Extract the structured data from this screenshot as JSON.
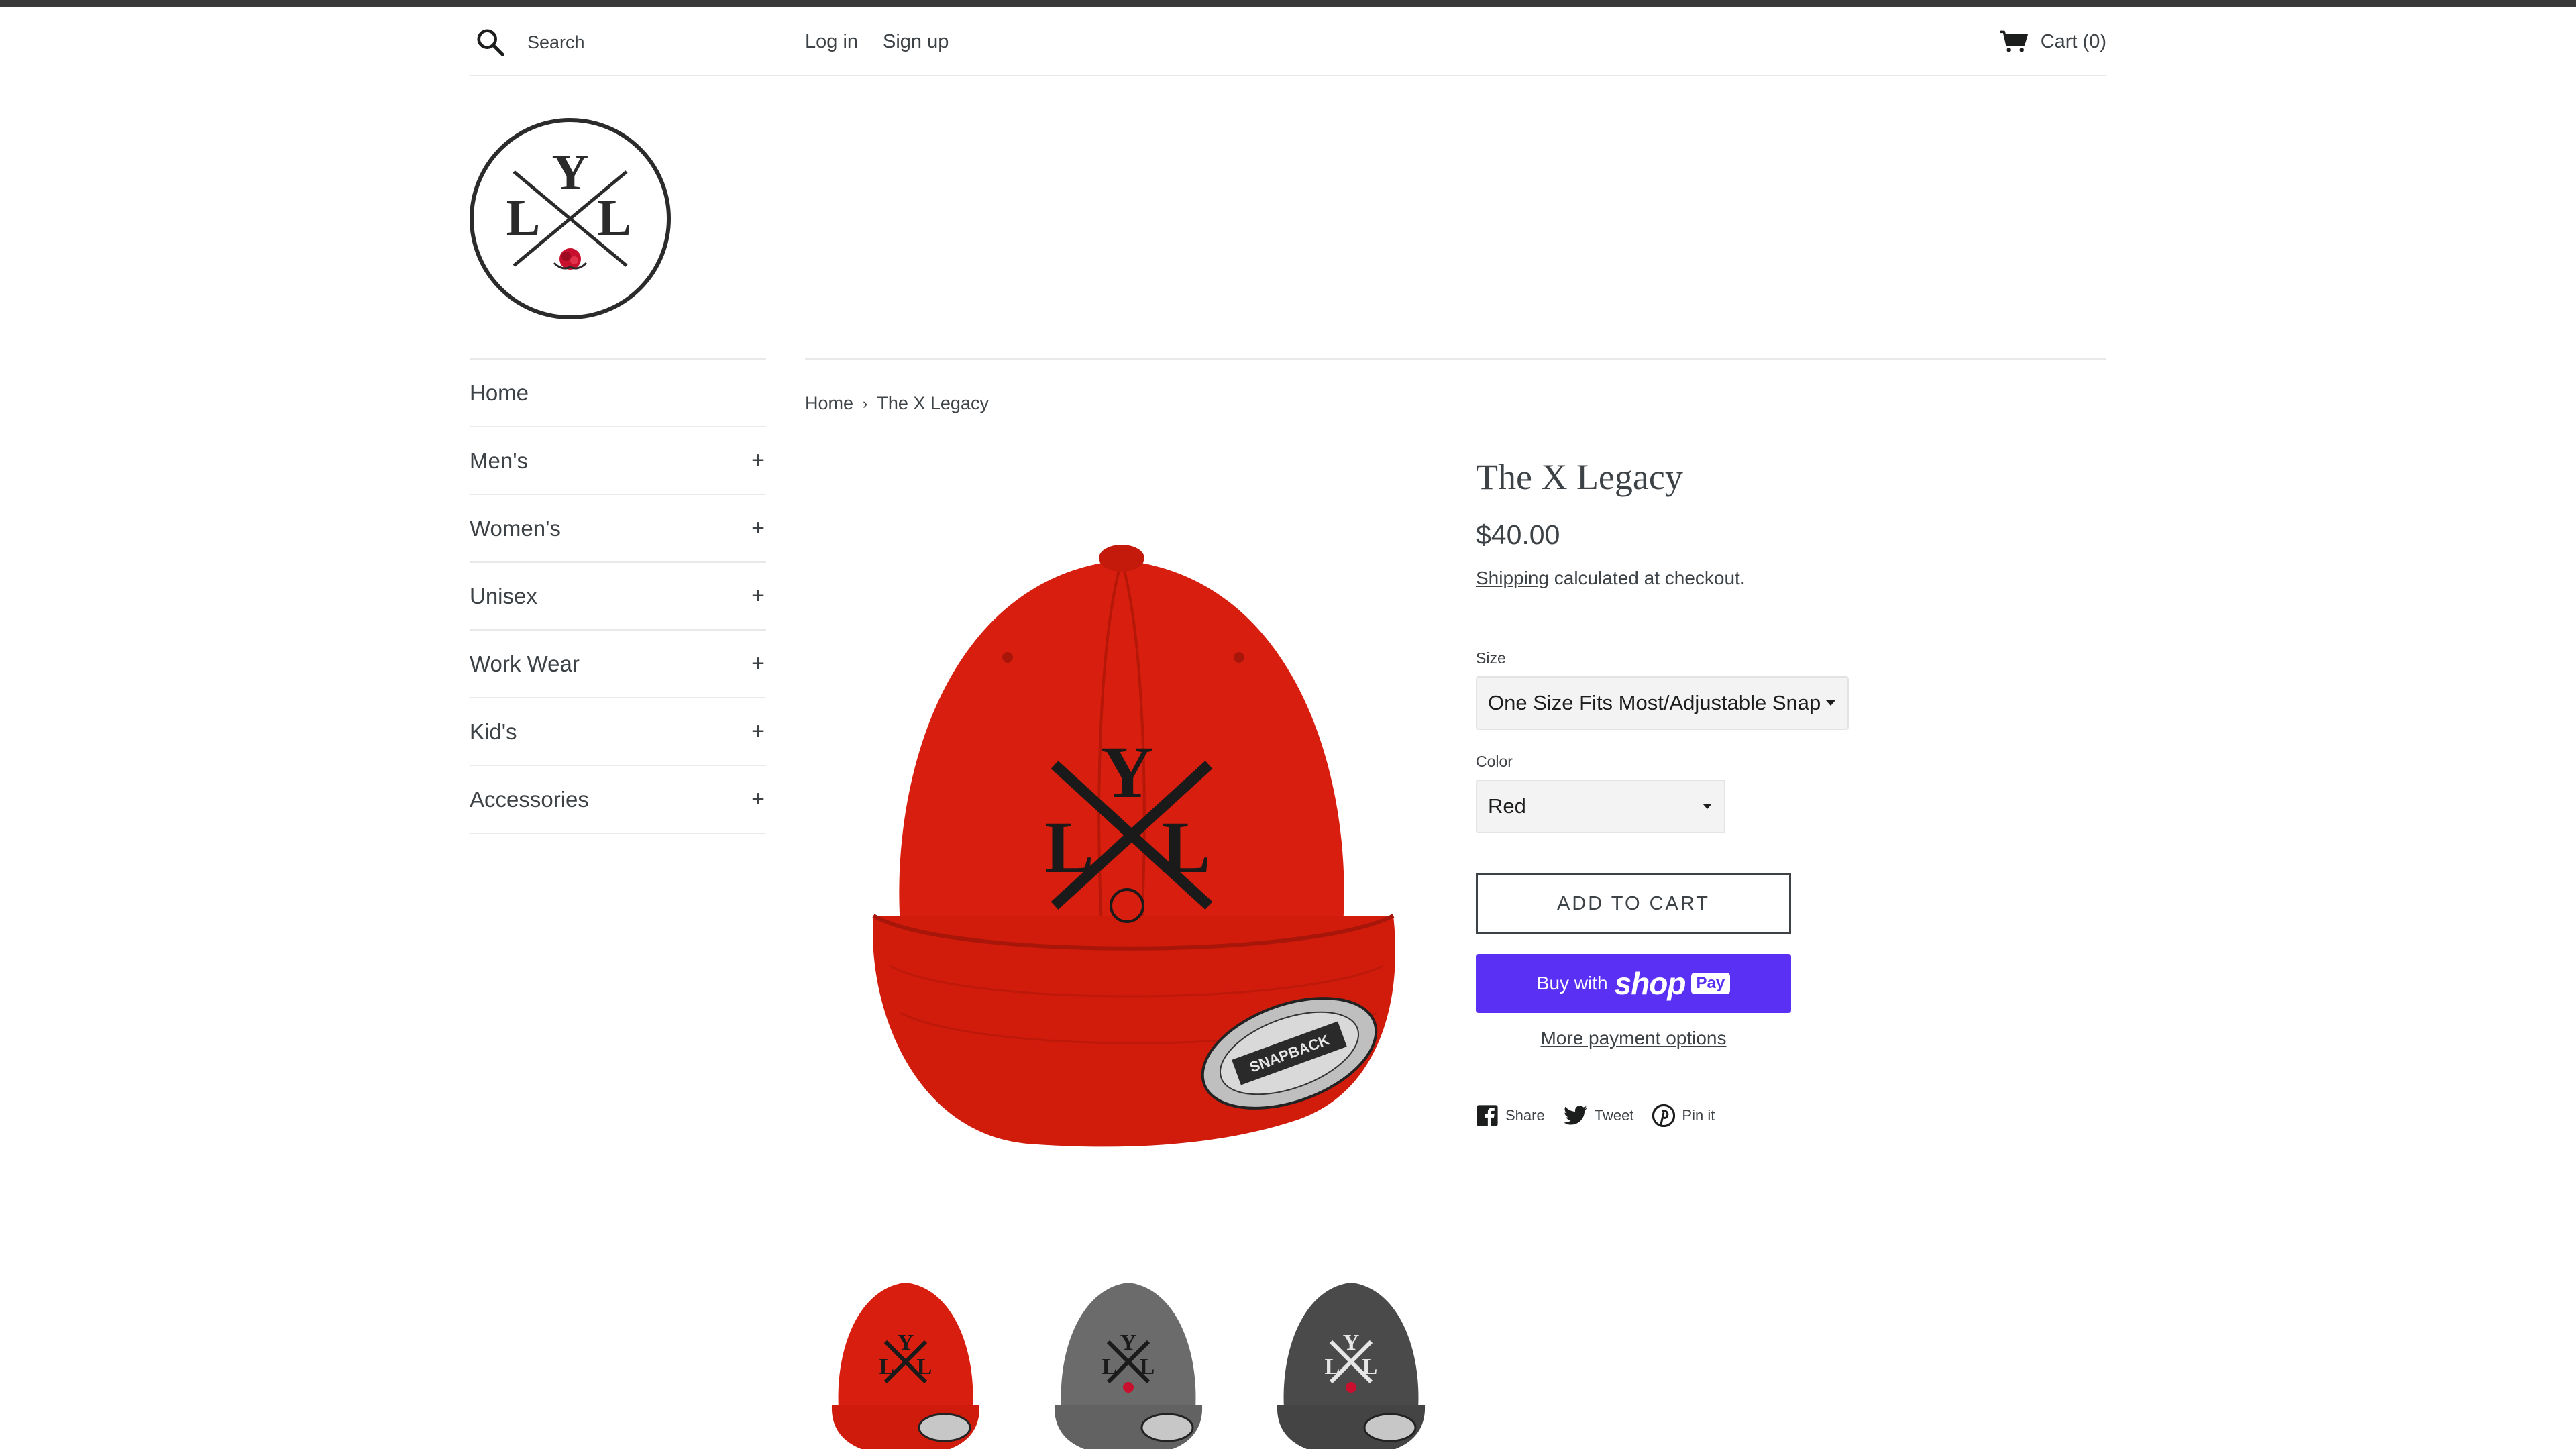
{
  "header": {
    "search_placeholder": "Search",
    "login": "Log in",
    "signup": "Sign up",
    "cart": "Cart (0)"
  },
  "logo": {
    "text": "LYL"
  },
  "sidebar": {
    "items": [
      {
        "label": "Home",
        "expandable": false
      },
      {
        "label": "Men's",
        "expandable": true
      },
      {
        "label": "Women's",
        "expandable": true
      },
      {
        "label": "Unisex",
        "expandable": true
      },
      {
        "label": "Work Wear",
        "expandable": true
      },
      {
        "label": "Kid's",
        "expandable": true
      },
      {
        "label": "Accessories",
        "expandable": true
      }
    ],
    "expand_symbol": "+"
  },
  "breadcrumb": {
    "home": "Home",
    "separator": "›",
    "current": "The X Legacy"
  },
  "product": {
    "title": "The X Legacy",
    "price": "$40.00",
    "shipping_link": "Shipping",
    "shipping_text": " calculated at checkout.",
    "size_label": "Size",
    "size_value": "One Size Fits Most/Adjustable Snap",
    "color_label": "Color",
    "color_value": "Red",
    "add_to_cart": "ADD TO CART",
    "shop_pay_prefix": "Buy with",
    "shop_pay_word": "shop",
    "shop_pay_badge": "Pay",
    "more_payment": "More payment options",
    "image_colors": [
      "#d81f0f",
      "#6b6b6b",
      "#4a4a4a"
    ]
  },
  "social": {
    "share": "Share",
    "tweet": "Tweet",
    "pin": "Pin it"
  },
  "colors": {
    "text": "#3d4246",
    "border": "#e8e9eb",
    "shop_pay": "#5a31f4",
    "rose": "#c8102e"
  }
}
